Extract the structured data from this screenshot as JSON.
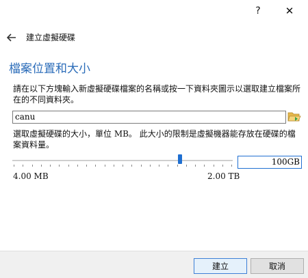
{
  "titlebar": {
    "help_label": "?",
    "close_label": "✕"
  },
  "wizard": {
    "title": "建立虛擬硬碟"
  },
  "section": {
    "title": "檔案位置和大小"
  },
  "location": {
    "instruction": "請在以下方塊輸入新虛擬硬碟檔案的名稱或按一下資料夾圖示以選取建立檔案所在的不同資料夾。",
    "value": "canu",
    "folder_icon": "folder-open-icon"
  },
  "size": {
    "description": "選取虛擬硬碟的大小，單位 MB。 此大小的限制是虛擬機器能存放在硬碟的檔案資料量。",
    "value": "100GB",
    "min_label": "4.00 MB",
    "max_label": "2.00 TB",
    "slider_fraction": 0.76,
    "tick_count": 25
  },
  "footer": {
    "create_label": "建立",
    "cancel_label": "取消"
  },
  "colors": {
    "accent": "#1f6fd1",
    "title": "#2b6cb9"
  }
}
